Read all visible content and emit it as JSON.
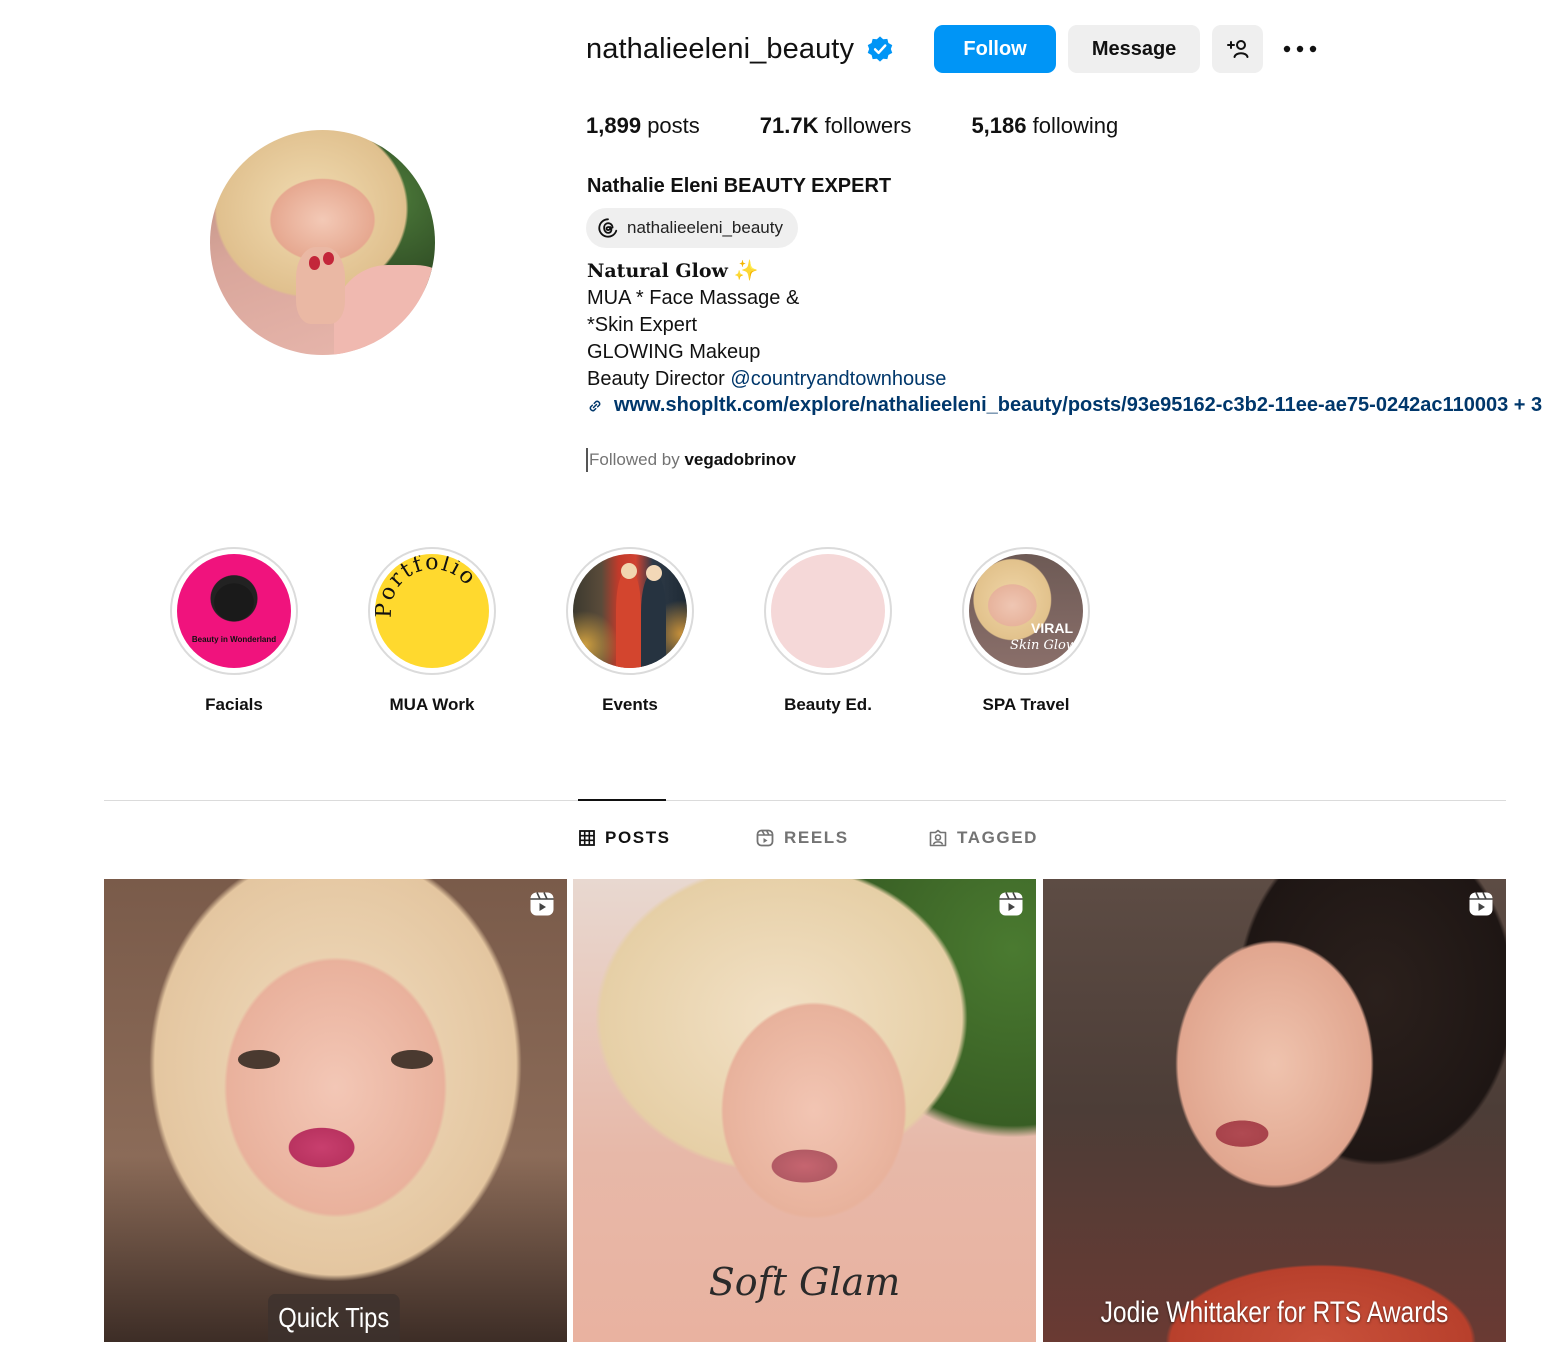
{
  "profile": {
    "username": "nathalieeleni_beauty",
    "verified": true,
    "follow_label": "Follow",
    "message_label": "Message",
    "stats": {
      "posts_count": "1,899",
      "posts_label": "posts",
      "followers_count": "71.7K",
      "followers_label": "followers",
      "following_count": "5,186",
      "following_label": "following"
    },
    "full_name": "Nathalie Eleni BEAUTY EXPERT",
    "threads_handle": "nathalieeleni_beauty",
    "bio": {
      "line1": "Natural Glow",
      "line1_emoji": "✨",
      "line2": "MUA * Face Massage &",
      "line3": "*Skin Expert",
      "line4": "GLOWING Makeup",
      "line5_prefix": "Beauty Director ",
      "line5_mention": "@countryandtownhouse"
    },
    "link": "www.shopltk.com/explore/nathalieeleni_beauty/posts/93e95162-c3b2-11ee-ae75-0242ac110003 + 3",
    "followed_by_prefix": "Followed by ",
    "followed_by_user": "vegadobrinov"
  },
  "highlights": [
    {
      "label": "Facials",
      "art_text": "Beauty in Wonderland"
    },
    {
      "label": "MUA Work",
      "art_text": "Portfolio"
    },
    {
      "label": "Events"
    },
    {
      "label": "Beauty Ed."
    },
    {
      "label": "SPA Travel",
      "art_text": "VIRAL",
      "art_script": "Skin Glow"
    }
  ],
  "tabs": [
    {
      "label": "POSTS",
      "active": true,
      "icon": "grid-icon"
    },
    {
      "label": "REELS",
      "active": false,
      "icon": "reels-icon"
    },
    {
      "label": "TAGGED",
      "active": false,
      "icon": "tagged-icon"
    }
  ],
  "posts": [
    {
      "caption": "Quick Tips",
      "type": "reel"
    },
    {
      "caption": "Soft Glam",
      "type": "reel"
    },
    {
      "caption": "Jodie Whittaker for RTS Awards",
      "type": "reel"
    }
  ],
  "colors": {
    "accent": "#0095f6",
    "link": "#00376b",
    "muted": "#737373"
  }
}
